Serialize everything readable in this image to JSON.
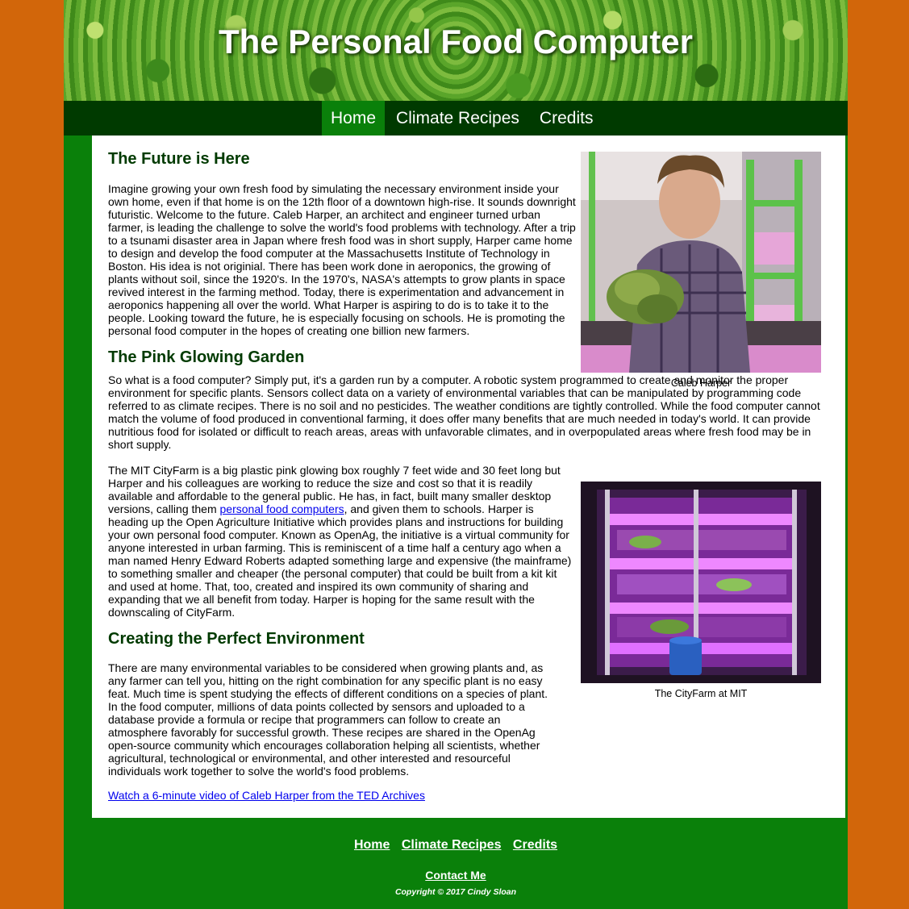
{
  "header": {
    "title": "The Personal Food Computer"
  },
  "nav": {
    "items": [
      {
        "label": "Home",
        "active": true
      },
      {
        "label": "Climate Recipes"
      },
      {
        "label": "Credits"
      }
    ]
  },
  "sections": {
    "s1_heading": "The Future is Here",
    "s1_p1": "Imagine growing your own fresh food by simulating the necessary environment inside your own home, even if that home is on the 12th floor of a downtown high-rise. It sounds downright futuristic. Welcome to the future. Caleb Harper, an architect and engineer turned urban farmer, is leading the challenge to solve the world's food problems with technology. After a trip to a tsunami disaster area in Japan where fresh food was in short supply, Harper came home to design and develop the food computer at the Massachusetts Institute of Technology in Boston. His idea is not originial. There has been work done in aeroponics, the growing of plants without soil, since the 1920's. In the 1970's, NASA's attempts to grow plants in space revived interest in the farming method. Today, there is experimentation and advancement in aeroponics happening all over the world. What Harper is aspiring to do is to take it to the people. Looking toward the future, he is especially focusing on schools. He is promoting the personal food computer in the hopes of creating one billion new farmers.",
    "s2_heading": "The Pink Glowing Garden",
    "s2_p1": "So what is a food computer? Simply put, it's a garden run by a computer. A robotic system programmed to create and monitor the proper environment for specific plants. Sensors collect data on a variety of environmental variables that can be manipulated by programming code referred to as climate recipes. There is no soil and no pesticides. The weather conditions are tightly controlled. While the food computer cannot match the volume of food produced in conventional farming, it does offer many benefits that are much needed in today's world. It can provide nutritious food for isolated or difficult to reach areas, areas with unfavorable climates, and in overpopulated areas where fresh food may be in short supply.",
    "s2_p2_before": "The MIT CityFarm is a big plastic pink glowing box roughly 7 feet wide and 30 feet long but Harper and his colleagues are working to reduce the size and cost so that it is readily available and affordable to the general public. He has, in fact, built many smaller desktop versions, calling them ",
    "s2_p2_link": "personal food computers",
    "s2_p2_after": ", and given them to schools. Harper is heading up the Open Agriculture Initiative which provides plans and instructions for building your own personal food computer. Known as OpenAg, the initiative is a virtual community for anyone interested in urban farming. This is reminiscent of a time half a century ago when a man named Henry Edward Roberts adapted something large and expensive (the mainframe) to something smaller and cheaper (the personal computer) that could be built from a kit kit and used at home. That, too, created and inspired its own community of sharing and expanding that we all benefit from today. Harper is hoping for the same result with the downscaling of CityFarm.",
    "s3_heading": "Creating the Perfect Environment",
    "s3_p1": "There are many environmental variables to be considered when growing plants and, as any farmer can tell you, hitting on the right combination for any specific plant is no easy feat. Much time is spent studying the effects of different conditions on a species of plant. In the food computer, millions of data points collected by sensors and uploaded to a database provide a formula or recipe that programmers can follow to create an atmosphere favorably for successful growth. These recipes are shared in the OpenAg open-source community which encourages collaboration helping all scientists, whether agricultural, technological or environmental, and other interested and resourceful individuals work together to solve the world's food problems.",
    "video_link": "Watch a 6-minute video of Caleb Harper from the TED Archives"
  },
  "figures": {
    "fig1_caption": "Caleb Harper",
    "fig2_caption": "The CityFarm at MIT"
  },
  "footer": {
    "links": [
      "Home",
      "Climate Recipes",
      "Credits"
    ],
    "contact": "Contact Me",
    "copyright": "Copyright © 2017 Cindy Sloan"
  }
}
